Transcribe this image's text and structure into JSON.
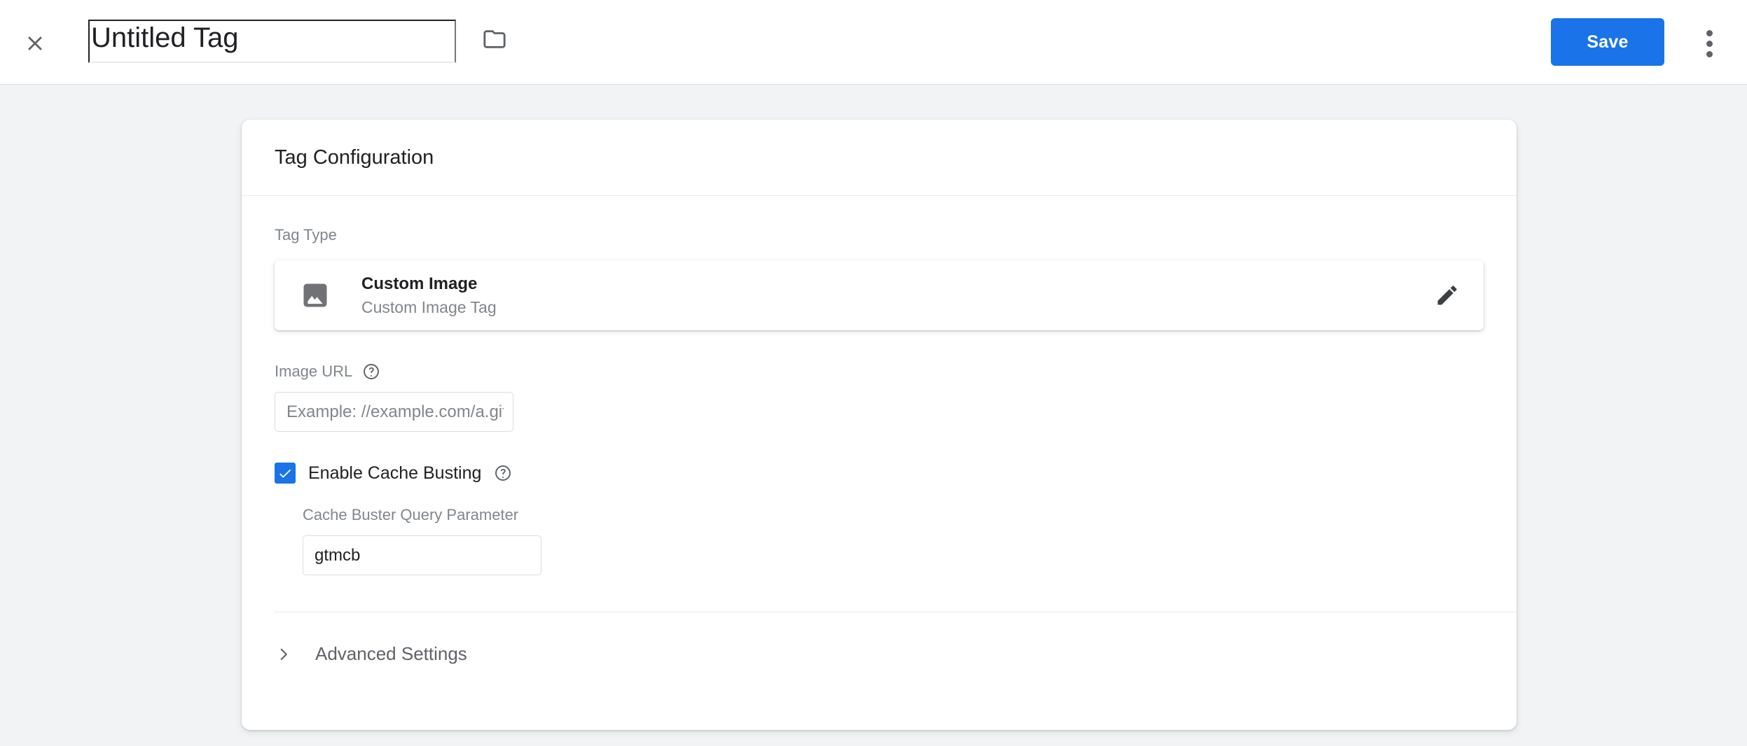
{
  "header": {
    "close_icon": "close-icon",
    "title": "Untitled Tag",
    "title_placeholder": "Untitled Tag",
    "folder_icon": "folder-icon",
    "save_label": "Save",
    "more_icon": "more-vert-icon",
    "accent_color": "#1a73e8"
  },
  "card": {
    "title": "Tag Configuration",
    "tag_type": {
      "label": "Tag Type",
      "icon": "image-icon",
      "name": "Custom Image",
      "description": "Custom Image Tag",
      "edit_icon": "pencil-icon"
    },
    "image_url": {
      "label": "Image URL",
      "help_icon": "help-circle-icon",
      "value": "",
      "placeholder": "Example: //example.com/a.gif",
      "variable_picker_icon": "variable-brick-icon"
    },
    "cache_busting": {
      "checked": true,
      "label": "Enable Cache Busting",
      "help_icon": "help-circle-icon",
      "param_label": "Cache Buster Query Parameter",
      "param_value": "gtmcb",
      "param_placeholder": "",
      "variable_picker_icon": "variable-brick-icon"
    },
    "advanced_settings": {
      "label": "Advanced Settings",
      "chevron_icon": "chevron-right-icon",
      "expanded": false
    }
  },
  "colors": {
    "page_background": "#f1f3f4",
    "surface": "#ffffff",
    "primary_text": "#202124",
    "secondary_text": "#80868b",
    "accent": "#1a73e8",
    "border": "#dadce0"
  }
}
